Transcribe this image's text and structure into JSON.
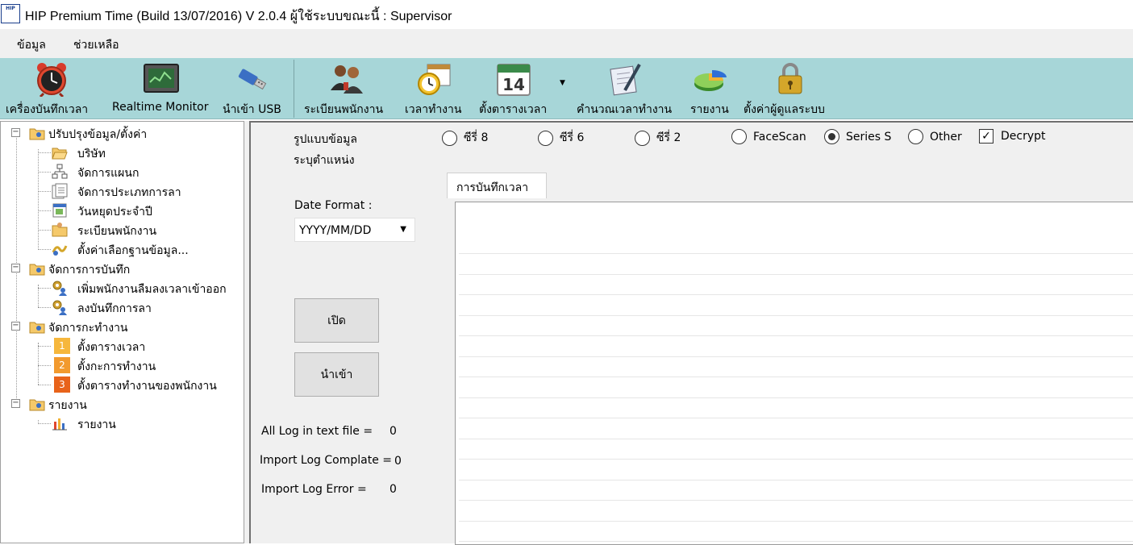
{
  "window": {
    "app_icon_text": "HIP",
    "title": "HIP Premium Time (Build 13/07/2016) V 2.0.4    ผู้ใช้ระบบขณะนี้  : Supervisor"
  },
  "menu": [
    "ข้อมูล",
    "ช่วยเหลือ"
  ],
  "toolbar": [
    {
      "label": "เครื่องบันทึกเวลา",
      "icon": "alarm-clock-icon"
    },
    {
      "label": "Realtime Monitor",
      "icon": "monitor-icon"
    },
    {
      "label": "นำเข้า USB",
      "icon": "usb-icon"
    },
    {
      "label": "ระเบียนพนักงาน",
      "icon": "employees-icon"
    },
    {
      "label": "เวลาทำงาน",
      "icon": "clock-calendar-icon"
    },
    {
      "label": "ตั้งตารางเวลา",
      "icon": "calendar-icon",
      "calendar_day": "14"
    },
    {
      "label": "คำนวณเวลาทำงาน",
      "icon": "document-pen-icon"
    },
    {
      "label": "รายงาน",
      "icon": "pie-chart-icon"
    },
    {
      "label": "ตั้งค่าผู้ดูแลระบบ",
      "icon": "padlock-icon"
    }
  ],
  "tree": {
    "groups": [
      {
        "label": "ปรับปรุงข้อมูล/ตั้งค่า",
        "expanded": true,
        "children": [
          {
            "label": "บริษัท",
            "icon": "folder-open-icon"
          },
          {
            "label": "จัดการแผนก",
            "icon": "org-chart-icon"
          },
          {
            "label": "จัดการประเภทการลา",
            "icon": "form-icon"
          },
          {
            "label": "วันหยุดประจำปี",
            "icon": "holiday-icon"
          },
          {
            "label": "ระเบียนพนักงาน",
            "icon": "employee-folder-icon"
          },
          {
            "label": "ตั้งค่าเลือกฐานข้อมูล...",
            "icon": "database-icon"
          }
        ]
      },
      {
        "label": "จัดการการบันทึก",
        "expanded": true,
        "children": [
          {
            "label": "เพิ่มพนักงานลืมลงเวลาเข้าออก",
            "icon": "gear-person-icon"
          },
          {
            "label": "ลงบันทึกการลา",
            "icon": "gear-person-icon"
          }
        ]
      },
      {
        "label": "จัดการกะทำงาน",
        "expanded": true,
        "children": [
          {
            "label": "ตั้งตารางเวลา",
            "icon": "step-1-icon",
            "badge": "1",
            "color": "#f6b73c"
          },
          {
            "label": "ตั้งกะการทำงาน",
            "icon": "step-2-icon",
            "badge": "2",
            "color": "#f29a2e"
          },
          {
            "label": "ตั้งตารางทำงานของพนักงาน",
            "icon": "step-3-icon",
            "badge": "3",
            "color": "#e8631a"
          }
        ]
      },
      {
        "label": "รายงาน",
        "expanded": true,
        "children": [
          {
            "label": "รายงาน",
            "icon": "bar-chart-icon"
          }
        ]
      }
    ]
  },
  "panel": {
    "data_format_label": "รูปแบบข้อมูล",
    "position_label": "ระบุตำแหน่ง",
    "radios": [
      {
        "label": "ซีรี่ 8",
        "selected": false
      },
      {
        "label": "ซีรี่ 6",
        "selected": false
      },
      {
        "label": "ซีรี่ 2",
        "selected": false
      },
      {
        "label": "FaceScan",
        "selected": false
      },
      {
        "label": "Series S",
        "selected": true
      },
      {
        "label": "Other",
        "selected": false
      }
    ],
    "decrypt": {
      "label": "Decrypt",
      "checked": true,
      "mark": "✓"
    },
    "date_format_label": "Date Format :",
    "date_format_value": "YYYY/MM/DD",
    "open_button": "เปิด",
    "import_button": "นำเข้า",
    "stats": [
      {
        "label": "All Log in text file =",
        "value": "0"
      },
      {
        "label": "Import Log Complate =",
        "value": "0"
      },
      {
        "label": "Import Log Error =",
        "value": "0"
      }
    ],
    "tab_label": "การบันทึกเวลา"
  }
}
